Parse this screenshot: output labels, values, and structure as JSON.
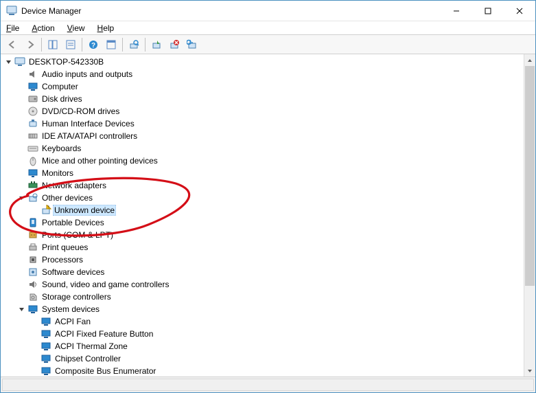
{
  "window": {
    "title": "Device Manager"
  },
  "menus": {
    "file": "File",
    "action": "Action",
    "view": "View",
    "help": "Help"
  },
  "tree": {
    "root": "DESKTOP-542330B",
    "nodes": [
      {
        "label": "Audio inputs and outputs",
        "icon": "audio"
      },
      {
        "label": "Computer",
        "icon": "computer"
      },
      {
        "label": "Disk drives",
        "icon": "disk"
      },
      {
        "label": "DVD/CD-ROM drives",
        "icon": "dvd"
      },
      {
        "label": "Human Interface Devices",
        "icon": "hid"
      },
      {
        "label": "IDE ATA/ATAPI controllers",
        "icon": "ide"
      },
      {
        "label": "Keyboards",
        "icon": "keyboard"
      },
      {
        "label": "Mice and other pointing devices",
        "icon": "mouse"
      },
      {
        "label": "Monitors",
        "icon": "monitor"
      },
      {
        "label": "Network adapters",
        "icon": "network"
      },
      {
        "label": "Other devices",
        "icon": "other",
        "expanded": true,
        "children": [
          {
            "label": "Unknown device",
            "icon": "unknown",
            "selected": true
          }
        ]
      },
      {
        "label": "Portable Devices",
        "icon": "portable"
      },
      {
        "label": "Ports (COM & LPT)",
        "icon": "ports"
      },
      {
        "label": "Print queues",
        "icon": "print"
      },
      {
        "label": "Processors",
        "icon": "cpu"
      },
      {
        "label": "Software devices",
        "icon": "software"
      },
      {
        "label": "Sound, video and game controllers",
        "icon": "sound"
      },
      {
        "label": "Storage controllers",
        "icon": "storage"
      },
      {
        "label": "System devices",
        "icon": "system",
        "expanded": true,
        "children": [
          {
            "label": "ACPI Fan",
            "icon": "system-sub"
          },
          {
            "label": "ACPI Fixed Feature Button",
            "icon": "system-sub"
          },
          {
            "label": "ACPI Thermal Zone",
            "icon": "system-sub"
          },
          {
            "label": "Chipset Controller",
            "icon": "system-sub"
          },
          {
            "label": "Composite Bus Enumerator",
            "icon": "system-sub"
          }
        ]
      }
    ]
  },
  "annotation": {
    "color": "#d40e17"
  }
}
